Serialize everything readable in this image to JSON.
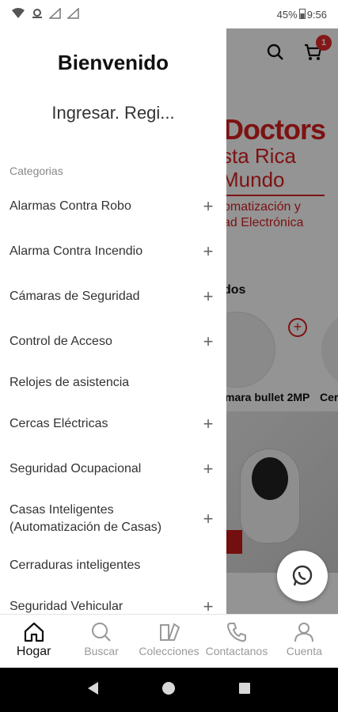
{
  "status": {
    "battery": "45%",
    "time": "9:56"
  },
  "drawer": {
    "welcome": "Bienvenido",
    "login": "Ingresar. Regi...",
    "categories_title": "Categorias",
    "items": [
      {
        "label": "Alarmas Contra Robo",
        "expandable": true
      },
      {
        "label": "Alarma Contra Incendio",
        "expandable": true
      },
      {
        "label": "Cámaras de Seguridad",
        "expandable": true
      },
      {
        "label": "Control de Acceso",
        "expandable": true
      },
      {
        "label": "Relojes de asistencia",
        "expandable": false
      },
      {
        "label": "Cercas Eléctricas",
        "expandable": true
      },
      {
        "label": "Seguridad Ocupacional",
        "expandable": true
      },
      {
        "label": "Casas Inteligentes (Automatización de Casas)",
        "expandable": true
      },
      {
        "label": "Cerraduras inteligentes",
        "expandable": false
      },
      {
        "label": "Seguridad Vehicular",
        "expandable": true
      }
    ]
  },
  "background": {
    "cart_count": "1",
    "banner_line1": "Doctors",
    "banner_line2": "sta Rica",
    "banner_line3": "Mundo",
    "banner_line4": "omatización y",
    "banner_line5": "ad Electrónica",
    "section_title": "dos",
    "product1": "mara bullet 2MP",
    "product2": "Cer"
  },
  "bottom_nav": {
    "items": [
      {
        "label": "Hogar",
        "icon": "home-icon",
        "active": true
      },
      {
        "label": "Buscar",
        "icon": "search-icon",
        "active": false
      },
      {
        "label": "Colecciones",
        "icon": "collections-icon",
        "active": false
      },
      {
        "label": "Contactanos",
        "icon": "phone-icon",
        "active": false
      },
      {
        "label": "Cuenta",
        "icon": "account-icon",
        "active": false
      }
    ]
  },
  "colors": {
    "accent": "#d82020",
    "badge": "#e32a2a"
  }
}
